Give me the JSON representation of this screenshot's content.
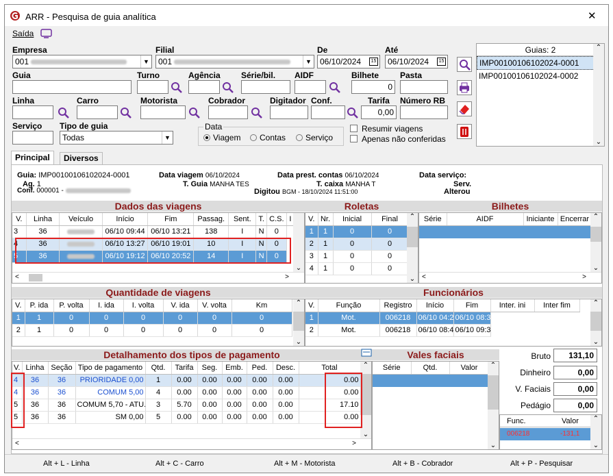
{
  "window": {
    "title": "ARR - Pesquisa de guia analítica",
    "close": "✕"
  },
  "menu": {
    "exit": "Saída"
  },
  "filters": {
    "empresa_label": "Empresa",
    "empresa_value": "001",
    "filial_label": "Filial",
    "filial_value": "001",
    "de_label": "De",
    "de_value": "06/10/2024",
    "ate_label": "Até",
    "ate_value": "06/10/2024",
    "guia_label": "Guia",
    "turno_label": "Turno",
    "agencia_label": "Agência",
    "serie_label": "Série/bil.",
    "aidf_label": "AIDF",
    "bilhete_label": "Bilhete",
    "bilhete_value": "0",
    "pasta_label": "Pasta",
    "linha_label": "Linha",
    "carro_label": "Carro",
    "motorista_label": "Motorista",
    "cobrador_label": "Cobrador",
    "digitador_label": "Digitador",
    "conf_label": "Conf.",
    "tarifa_label": "Tarifa",
    "tarifa_value": "0,00",
    "numero_rb_label": "Número RB",
    "servico_label": "Serviço",
    "tipo_guia_label": "Tipo de guia",
    "tipo_guia_value": "Todas",
    "data_group": "Data",
    "radio_viagem": "Viagem",
    "radio_contas": "Contas",
    "radio_servico": "Serviço",
    "chk_resumir": "Resumir viagens",
    "chk_apenas": "Apenas não conferidas"
  },
  "guias": {
    "header": "Guias: 2",
    "items": [
      "IMP00100106102024-0001",
      "IMP00100106102024-0002"
    ]
  },
  "tabs": [
    "Principal",
    "Diversos"
  ],
  "info": {
    "guia_label": "Guia:",
    "guia_value": "IMP00100106102024-0001",
    "ag_label": "Ag.",
    "ag_value": "1",
    "conf_label": "Conf.",
    "conf_value": "000001 -",
    "data_viagem_label": "Data viagem",
    "data_viagem_value": "06/10/2024",
    "tguia_label": "T. Guia",
    "tguia_value": "MANHA TES",
    "data_prest_label": "Data prest. contas",
    "data_prest_value": "06/10/2024",
    "tcaixa_label": "T. caixa",
    "tcaixa_value": "MANHA T",
    "digitou_label": "Digitou",
    "digitou_value": "BGM - 18/10/2024 11:51:00",
    "data_servico_label": "Data serviço:",
    "serv_label": "Serv.",
    "alterou_label": "Alterou"
  },
  "viagens": {
    "title": "Dados das viagens",
    "cols": [
      "V.",
      "Linha",
      "Veículo",
      "Início",
      "Fim",
      "Passag.",
      "Sent.",
      "T.",
      "C.S.",
      "I"
    ],
    "rows": [
      [
        "3",
        "36",
        "",
        "06/10 09:44",
        "06/10 13:21",
        "138",
        "I",
        "N",
        "0"
      ],
      [
        "4",
        "36",
        "",
        "06/10 13:27",
        "06/10 19:01",
        "10",
        "I",
        "N",
        "0"
      ],
      [
        "5",
        "36",
        "",
        "06/10 19:12",
        "06/10 20:52",
        "14",
        "I",
        "N",
        "0"
      ]
    ]
  },
  "roletas": {
    "title": "Roletas",
    "cols": [
      "V.",
      "Nr.",
      "Inicial",
      "Final"
    ],
    "rows": [
      [
        "1",
        "1",
        "0",
        "0"
      ],
      [
        "2",
        "1",
        "0",
        "0"
      ],
      [
        "3",
        "1",
        "0",
        "0"
      ],
      [
        "4",
        "1",
        "0",
        "0"
      ]
    ]
  },
  "bilhetes": {
    "title": "Bilhetes",
    "cols": [
      "Série",
      "AIDF",
      "Iniciante",
      "Encerrar"
    ]
  },
  "qtd": {
    "title": "Quantidade de viagens",
    "cols": [
      "V.",
      "P. ida",
      "P. volta",
      "I. ida",
      "I. volta",
      "V. ida",
      "V. volta",
      "Km"
    ],
    "rows": [
      [
        "1",
        "1",
        "0",
        "0",
        "0",
        "0",
        "0",
        "0"
      ],
      [
        "2",
        "1",
        "0",
        "0",
        "0",
        "0",
        "0",
        "0"
      ]
    ]
  },
  "func": {
    "title": "Funcionários",
    "cols": [
      "V.",
      "Função",
      "Registro",
      "Início",
      "Fim",
      "Inter. ini",
      "Inter fim"
    ],
    "rows": [
      [
        "1",
        "Mot.",
        "006218",
        "06/10 04:23",
        "06/10 08:37"
      ],
      [
        "2",
        "Mot.",
        "006218",
        "06/10 08:48",
        "06/10 09:31"
      ]
    ]
  },
  "pag": {
    "title": "Detalhamento dos tipos de pagamento",
    "cols": [
      "V.",
      "Linha",
      "Seção",
      "Tipo de pagamento",
      "Qtd.",
      "Tarifa",
      "Seg.",
      "Emb.",
      "Ped.",
      "Desc.",
      "Total"
    ],
    "rows": [
      [
        "4",
        "36",
        "36",
        "PRIORIDADE 0,00",
        "1",
        "0.00",
        "0.00",
        "0.00",
        "0.00",
        "0.00",
        "0.00"
      ],
      [
        "4",
        "36",
        "36",
        "COMUM 5,00",
        "4",
        "0.00",
        "0.00",
        "0.00",
        "0.00",
        "0.00",
        "0.00"
      ],
      [
        "5",
        "36",
        "36",
        "COMUM 5,70 - ATU...",
        "3",
        "5.70",
        "0.00",
        "0.00",
        "0.00",
        "0.00",
        "17.10"
      ],
      [
        "5",
        "36",
        "36",
        "SM 0,00",
        "5",
        "0.00",
        "0.00",
        "0.00",
        "0.00",
        "0.00",
        "0.00"
      ]
    ]
  },
  "vales": {
    "title": "Vales faciais",
    "cols": [
      "Série",
      "Qtd.",
      "Valor"
    ]
  },
  "totais": {
    "bruto_label": "Bruto",
    "bruto": "131,10",
    "dinheiro_label": "Dinheiro",
    "dinheiro": "0,00",
    "vfaciais_label": "V. Faciais",
    "vfaciais": "0,00",
    "pedagio_label": "Pedágio",
    "pedagio": "0,00",
    "func_col": "Func.",
    "valor_col": "Valor",
    "func_row": "006218",
    "valor_row": "-131,1"
  },
  "status": [
    "Alt + L - Linha",
    "Alt + C - Carro",
    "Alt + M - Motorista",
    "Alt + B - Cobrador",
    "Alt + P - Pesquisar"
  ]
}
